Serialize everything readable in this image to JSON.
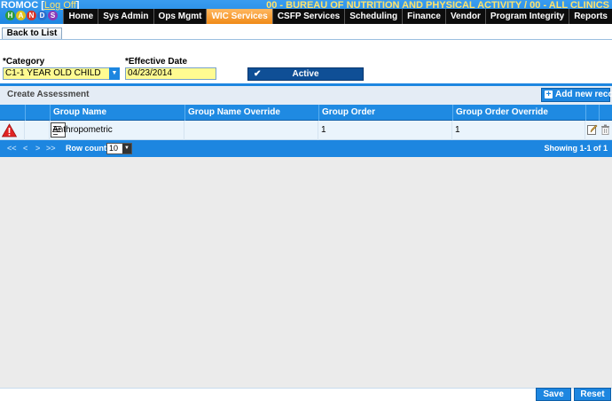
{
  "header": {
    "user": "ROMOC",
    "logoff_label": "Log Off",
    "organization": "00 - BUREAU OF NUTRITION AND PHYSICAL ACTIVITY / 00 - ALL CLINICS",
    "logo_text": "HANDS"
  },
  "nav": {
    "items": [
      {
        "label": "Home"
      },
      {
        "label": "Sys Admin"
      },
      {
        "label": "Ops Mgmt"
      },
      {
        "label": "WIC Services",
        "active": true
      },
      {
        "label": "CSFP Services"
      },
      {
        "label": "Scheduling"
      },
      {
        "label": "Finance"
      },
      {
        "label": "Vendor"
      },
      {
        "label": "Program Integrity"
      },
      {
        "label": "Reports"
      }
    ]
  },
  "toolbar": {
    "back_label": "Back to List"
  },
  "form": {
    "category_label": "*Category",
    "category_value": "C1-1 YEAR OLD CHILD",
    "effective_date_label": "*Effective Date",
    "effective_date_value": "04/23/2014",
    "status_label": "Active"
  },
  "panel": {
    "title": "Create Assessment",
    "add_label": "Add new record"
  },
  "grid": {
    "columns": [
      "Group Name",
      "Group Name Override",
      "Group Order",
      "Group Order Override"
    ],
    "rows": [
      {
        "group_name": "Anthropometric",
        "group_name_override": "",
        "group_order": "1",
        "group_order_override": "1"
      }
    ]
  },
  "pager": {
    "first": "<<",
    "prev": "<",
    "next": ">",
    "last": ">>",
    "row_count_label": "Row count:",
    "row_count_value": "10",
    "showing": "Showing 1-1 of 1"
  },
  "footer": {
    "save_label": "Save",
    "reset_label": "Reset"
  },
  "colors": {
    "primary": "#1d86e0",
    "active_nav": "#f08a18",
    "field_bg": "#fffb91",
    "status_button": "#0f4f96"
  }
}
